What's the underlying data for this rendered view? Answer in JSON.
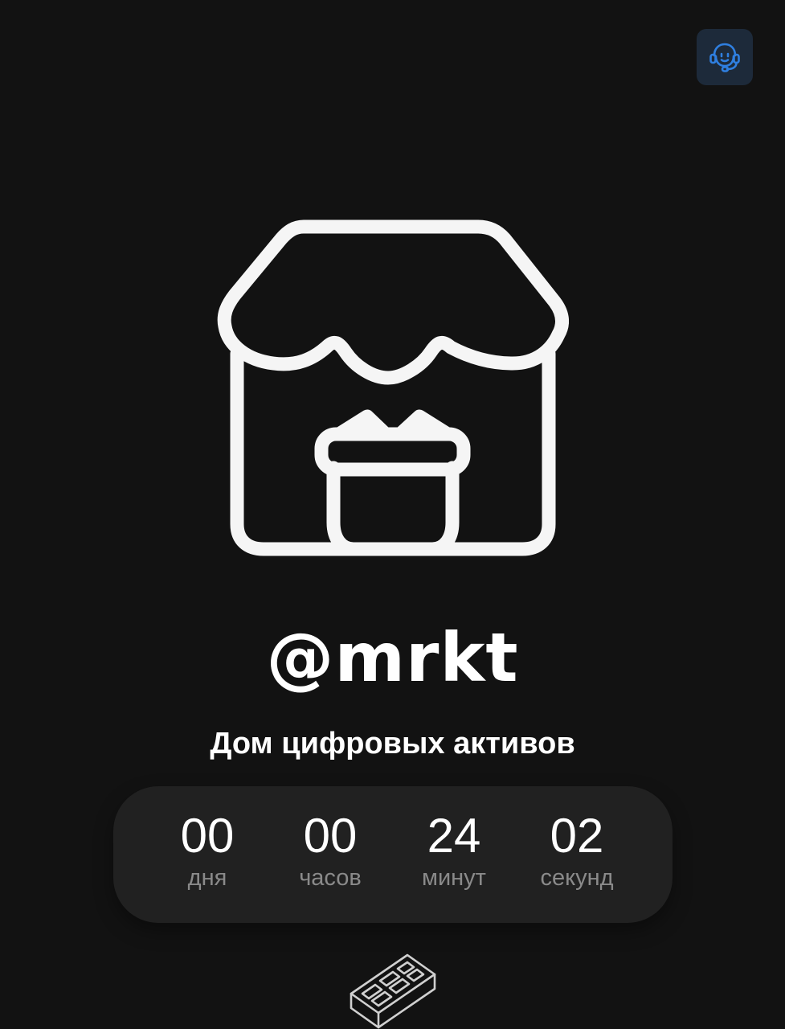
{
  "header": {
    "support_icon": "headset-support-icon",
    "accent_color": "#2f7fe0"
  },
  "logo": {
    "icon": "shop-gift-icon"
  },
  "brand": {
    "name": "@mrkt"
  },
  "tagline": "Дом цифровых активов",
  "countdown": {
    "units": [
      {
        "value": "00",
        "label": "дня"
      },
      {
        "value": "00",
        "label": "часов"
      },
      {
        "value": "24",
        "label": "минут"
      },
      {
        "value": "02",
        "label": "секунд"
      }
    ]
  },
  "footer": {
    "icon": "brick-icon"
  }
}
